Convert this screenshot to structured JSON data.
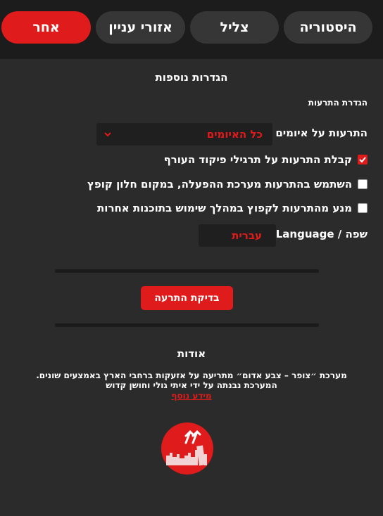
{
  "tabs": [
    {
      "label": "היסטוריה",
      "active": false
    },
    {
      "label": "צליל",
      "active": false
    },
    {
      "label": "אזורי עניין",
      "active": false
    },
    {
      "label": "אחר",
      "active": true
    }
  ],
  "settings": {
    "title": "הגדרות נוספות",
    "notifications_subtitle": "הגדרת התרעות",
    "threat_alerts_label": "התרעות על איומים",
    "threat_alerts_value": "כל האיומים",
    "checkbox_drills_label": "קבלת התרעות על תרגילי פיקוד העורף",
    "checkbox_drills_checked": true,
    "checkbox_os_notif_label": "השתמש בהתרעות מערכת ההפעלה, במקום חלון קופץ",
    "checkbox_os_notif_checked": false,
    "checkbox_no_popup_label": "מנע מהתרעות לקפוץ במהלך שימוש בתוכנות אחרות",
    "checkbox_no_popup_checked": false,
    "language_label": "Language / שפה",
    "language_value": "עברית"
  },
  "test_button_label": "בדיקת התרעה",
  "about": {
    "title": "אודות",
    "line1": "מערכת ״צופר – צבע אדום״ מתריעה על אזעקות ברחבי הארץ באמצעים שונים.",
    "line2": "המערכת נבנתה על ידי איתי גולי וחושן קדוש",
    "more_link": "מידע נוסף"
  },
  "colors": {
    "accent": "#e01b1b",
    "background": "#2b2b2b",
    "topbar": "#1c1c1c",
    "tab_inactive": "#363636"
  },
  "icons": {
    "select_arrow": "chevron-down-icon",
    "checkbox_check": "check-icon",
    "logo": "tzofar-logo-icon"
  }
}
